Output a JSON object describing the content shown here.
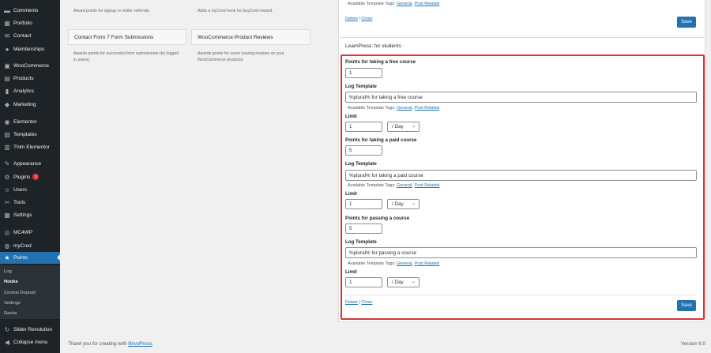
{
  "sidebar": {
    "items": [
      {
        "label": "Comments",
        "icon": "comments-icon"
      },
      {
        "label": "Portfolio",
        "icon": "portfolio-icon"
      },
      {
        "label": "Contact",
        "icon": "contact-icon"
      },
      {
        "label": "Memberships",
        "icon": "memberships-icon"
      },
      {
        "label": "WooCommerce",
        "icon": "woocommerce-icon"
      },
      {
        "label": "Products",
        "icon": "products-icon"
      },
      {
        "label": "Analytics",
        "icon": "analytics-icon"
      },
      {
        "label": "Marketing",
        "icon": "marketing-icon"
      },
      {
        "label": "Elementor",
        "icon": "elementor-icon"
      },
      {
        "label": "Templates",
        "icon": "templates-icon"
      },
      {
        "label": "Thim Elementor",
        "icon": "thim-elementor-icon"
      },
      {
        "label": "Appearance",
        "icon": "appearance-icon"
      },
      {
        "label": "Plugins",
        "icon": "plugins-icon",
        "badge": "1"
      },
      {
        "label": "Users",
        "icon": "users-icon"
      },
      {
        "label": "Tools",
        "icon": "tools-icon"
      },
      {
        "label": "Settings",
        "icon": "settings-icon"
      },
      {
        "label": "MC4WP",
        "icon": "mc4wp-icon"
      },
      {
        "label": "myCred",
        "icon": "mycred-icon"
      },
      {
        "label": "Points",
        "icon": "star-icon"
      },
      {
        "label": "Slider Revolution",
        "icon": "slider-revolution-icon"
      },
      {
        "label": "Collapse menu",
        "icon": "collapse-icon"
      }
    ],
    "submenu": [
      "Log",
      "Hooks",
      "Central Deposit",
      "Settings",
      "Ranks"
    ]
  },
  "hooks": {
    "top_left_desc": "Award points for signup or visitor referrals.",
    "top_mid_desc": "Adds a myCred hook for buyCred reward.",
    "cf7_title": "Contact Form 7 Form Submissions",
    "cf7_desc": "Awards points for successful form submissions (by logged in users).",
    "woo_title": "WooCommerce Product Reviews",
    "woo_desc": "Awards points for users leaving reviews on your WooCommerce products."
  },
  "top_box": {
    "tags_prefix": "Available Template Tags:",
    "tag_general": "General",
    "tag_post": "Post Related",
    "delete": "Delete",
    "sep": "|",
    "close": "Close",
    "save": "Save"
  },
  "learnpress": {
    "title": "LearnPress: for students",
    "blocks": [
      {
        "points_label": "Points for taking a free course",
        "points_value": "1",
        "log_label": "Log Template",
        "log_value": "%plural% for taking a free course",
        "limit_label": "Limit",
        "limit_value": "1",
        "limit_period": "/ Day"
      },
      {
        "points_label": "Points for taking a paid course",
        "points_value": "5",
        "log_label": "Log Template",
        "log_value": "%plural% for taking a paid course",
        "limit_label": "Limit",
        "limit_value": "1",
        "limit_period": "/ Day"
      },
      {
        "points_label": "Points for passing a course",
        "points_value": "5",
        "log_label": "Log Template",
        "log_value": "%plural% for passing a course",
        "limit_label": "Limit",
        "limit_value": "1",
        "limit_period": "/ Day"
      }
    ],
    "tags_prefix": "Available Template Tags:",
    "tag_general": "General",
    "tag_post": "Post Related",
    "delete": "Delete",
    "sep": "|",
    "close": "Close",
    "save": "Save"
  },
  "footer": {
    "text_prefix": "Thank you for creating with",
    "link": "WordPress",
    "suffix": ".",
    "version": "Version 6.0"
  },
  "colors": {
    "accent": "#2271b1",
    "highlight": "#d63638",
    "sidebar": "#1d2327"
  }
}
